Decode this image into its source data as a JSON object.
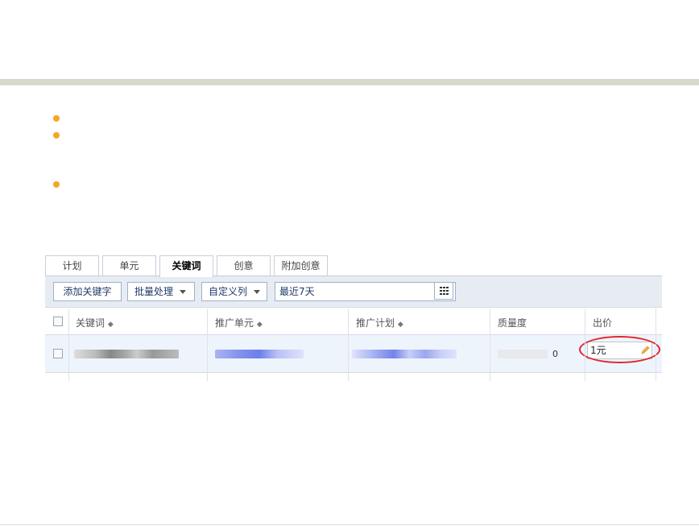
{
  "tabs": [
    {
      "label": "计划"
    },
    {
      "label": "单元"
    },
    {
      "label": "关键词"
    },
    {
      "label": "创意"
    },
    {
      "label": "附加创意"
    }
  ],
  "active_tab": "关键词",
  "toolbar": {
    "add_keyword": "添加关键字",
    "batch": "批量处理",
    "custom_columns": "自定义列",
    "date_range": "最近7天"
  },
  "table": {
    "columns": [
      "关键词",
      "推广单元",
      "推广计划",
      "质量度",
      "出价"
    ],
    "sort_icon": "◆",
    "row": {
      "quality_score": "0",
      "bid": "1元"
    }
  },
  "colors": {
    "bullet": "#f5a623",
    "highlight_oval": "#e0262a",
    "toolbar_bg": "#e7ecf3",
    "row_bg": "#eef4fc"
  }
}
